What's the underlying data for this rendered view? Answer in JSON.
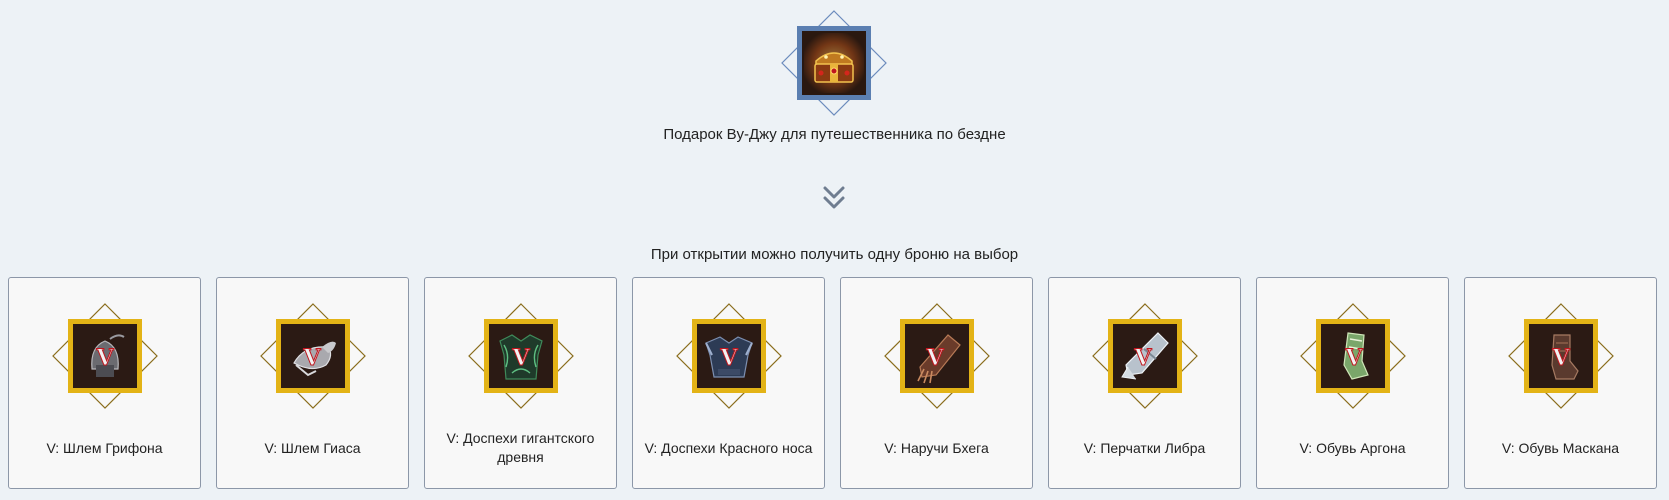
{
  "reward": {
    "title": "Подарок Ву-Джу для путешественника по бездне",
    "icon": "treasure-chest-icon"
  },
  "subtitle": "При открытии можно получить одну броню на выбор",
  "items": [
    {
      "label": "V: Шлем Грифона",
      "icon": "helmet-icon",
      "grade": "V"
    },
    {
      "label": "V: Шлем Гиаса",
      "icon": "helmet-icon",
      "grade": "V"
    },
    {
      "label": "V: Доспехи гигантского древня",
      "icon": "armor-icon",
      "grade": "V"
    },
    {
      "label": "V: Доспехи Красного носа",
      "icon": "armor-icon",
      "grade": "V"
    },
    {
      "label": "V: Наручи Бхега",
      "icon": "bracers-icon",
      "grade": "V"
    },
    {
      "label": "V: Перчатки Либра",
      "icon": "gloves-icon",
      "grade": "V"
    },
    {
      "label": "V: Обувь Аргона",
      "icon": "boots-icon",
      "grade": "V"
    },
    {
      "label": "V: Обувь Маскана",
      "icon": "boots-icon",
      "grade": "V"
    }
  ],
  "colors": {
    "background": "#edf2f6",
    "reward_frame": "#5b7fb1",
    "item_frame": "#e3b316",
    "item_diamond": "#8a6d1c",
    "grade_mark": "#e8e8e8"
  }
}
